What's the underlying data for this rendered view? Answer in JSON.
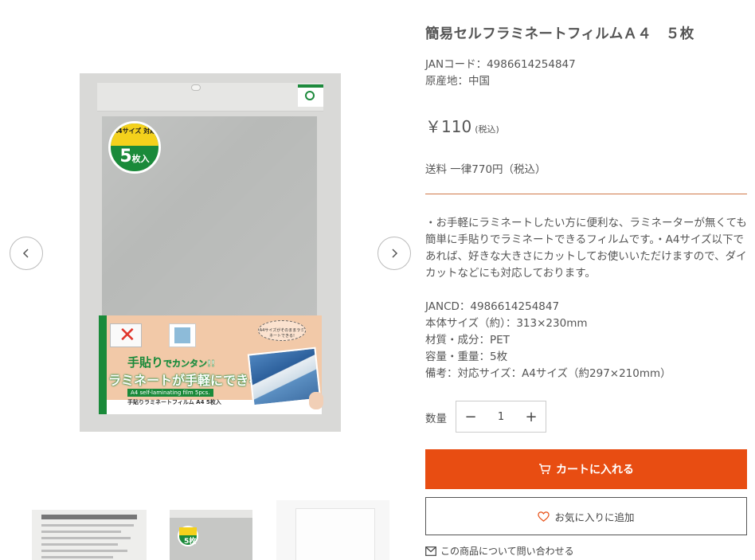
{
  "product": {
    "title": "簡易セルフラミネートフィルムＡ４　５枚",
    "jan": "JANコード：4986614254847",
    "origin": "原産地：中国",
    "price": "￥110",
    "tax_note": "(税込)",
    "shipping": "送料 一律770円（税込）",
    "description": "・お手軽にラミネートしたい方に便利な、ラミネーターが無くても簡単に手貼りでラミネートできるフィルムです。・A4サイズ以下であれば、好きな大きさにカットしてお使いいただけますので、ダイカットなどにも対応しております。",
    "specs": [
      "JANCD：4986614254847",
      "本体サイズ（約）：313×230mm",
      "材質・成分：PET",
      "容量・重量：5枚",
      "備考：対応サイズ：A4サイズ（約297×210mm）"
    ]
  },
  "package_image": {
    "badge_top": "A4サイズ 対応",
    "badge_count": "5",
    "badge_unit": "枚入",
    "card_line1_a": "手貼り",
    "card_line1_b": "でカンタン!!",
    "card_line2": "ラミネートが手軽にできる!!",
    "card_en": "A4 self-laminating film 5pcs.",
    "card_name": "手貼りラミネートフィルム A4 5枚入",
    "bubble": "A4サイズがそのままラミネートできる!",
    "thumb2_count": "5枚"
  },
  "quantity": {
    "label": "数量",
    "value": "1",
    "minus": "−",
    "plus": "+"
  },
  "actions": {
    "cart": "カートに入れる",
    "favorite": "お気に入りに追加",
    "inquiry": "この商品について問い合わせる"
  },
  "colors": {
    "accent": "#e84d12",
    "divider": "#d07a4a",
    "text": "#555555"
  },
  "icons": {
    "prev": "chevron-left-icon",
    "next": "chevron-right-icon",
    "cart": "cart-icon",
    "favorite": "heart-icon",
    "mail": "mail-icon"
  }
}
